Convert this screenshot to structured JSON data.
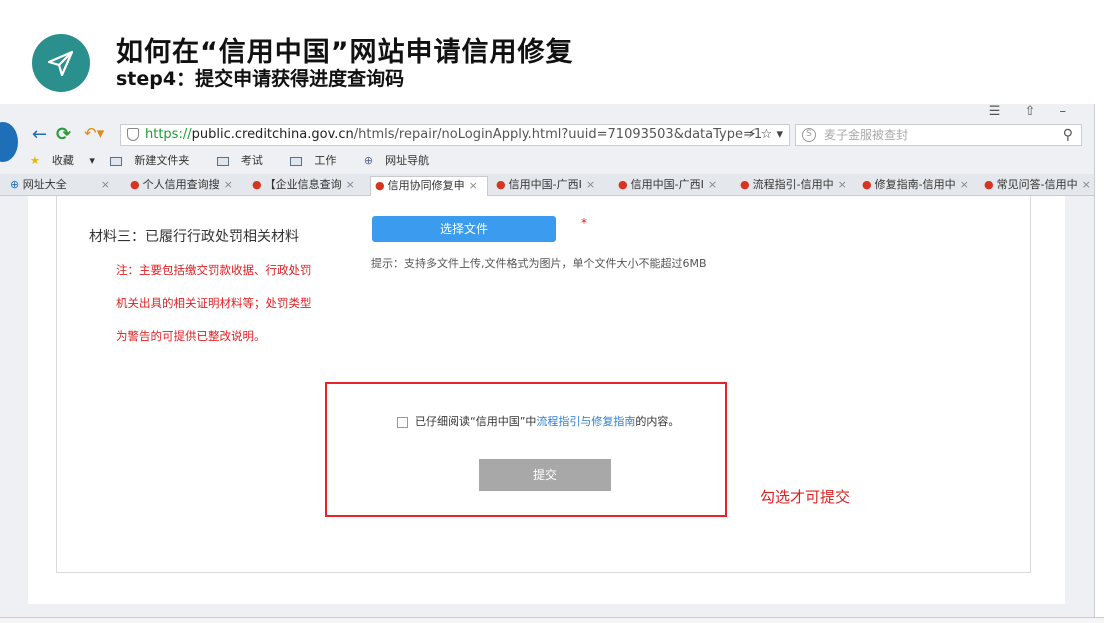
{
  "slide": {
    "title": "如何在“信用中国”网站申请信用修复",
    "subtitle": "step4：提交申请获得进度查询码",
    "icon": "paper-plane-icon"
  },
  "browser": {
    "url_https": "https://",
    "url_domain": "public.creditchina.gov.cn",
    "url_path": "/htmls/repair/noLoginApply.html?uuid=71093503&dataType=1",
    "search_placeholder": "麦子金服被查封",
    "bookmarks": [
      "收藏",
      "新建文件夹",
      "考试",
      "工作",
      "网址导航"
    ],
    "tabs": [
      "网址大全",
      "个人信用查询搜",
      "【企业信息查询",
      "信用协同修复申",
      "信用中国-广西I",
      "信用中国-广西I",
      "流程指引-信用中",
      "修复指南-信用中",
      "常见问答-信用中"
    ]
  },
  "form": {
    "material_label": "材料三：已履行行政处罚相关材料",
    "note_lines": [
      "注：主要包括缴交罚款收据、行政处罚",
      "机关出具的相关证明材料等；处罚类型",
      "为警告的可提供已整改说明。"
    ],
    "choose_file_label": "选择文件",
    "required_mark": "*",
    "tip": "提示：支持多文件上传,文件格式为图片，单个文件大小不能超过6MB",
    "agree_prefix": "已仔细阅读“信用中国”中",
    "agree_link": "流程指引与修复指南",
    "agree_suffix": "的内容。",
    "submit_label": "提交",
    "annotation": "勾选才可提交"
  },
  "colors": {
    "brand_teal": "#2a8f8d",
    "button_blue": "#3b9cef",
    "warning_red": "#e8232a",
    "disabled_gray": "#a8a8a8"
  }
}
